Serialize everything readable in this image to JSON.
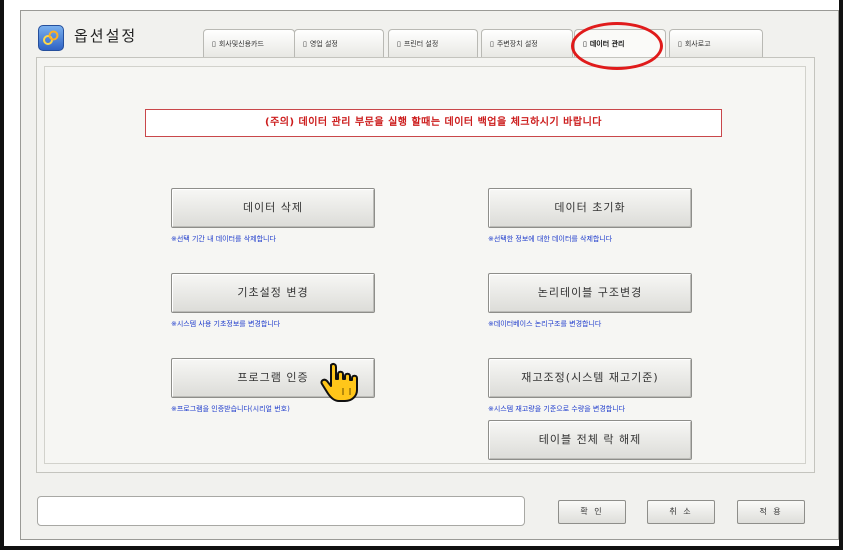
{
  "window": {
    "title": "옵션설정"
  },
  "tabs": [
    {
      "label": "회사및신용카드",
      "active": false
    },
    {
      "label": "영업 설정",
      "active": false
    },
    {
      "label": "프린터 설정",
      "active": false
    },
    {
      "label": "주변장치 설정",
      "active": false
    },
    {
      "label": "데이터 관리",
      "active": true
    },
    {
      "label": "회사로고",
      "active": false
    }
  ],
  "notice": "(주의) 데이터 관리 부문을 실행 할때는 데이터 백업을 체크하시기 바랍니다",
  "actions": {
    "delete_data": {
      "label": "데이터 삭제",
      "desc": "※선택 기간 내 데이터를 삭제합니다"
    },
    "init_data": {
      "label": "데이터 초기화",
      "desc": "※선택한 정보에 대한 데이터를 삭제합니다"
    },
    "base_settings": {
      "label": "기초설정 변경",
      "desc": "※시스템 사용 기초정보를 변경합니다"
    },
    "logic_table": {
      "label": "논리테이블 구조변경",
      "desc": "※데이터베이스 논리구조를 변경합니다"
    },
    "program_auth": {
      "label": "프로그램 인증",
      "desc": "※프로그램을 인증받습니다(시리얼 번호)"
    },
    "stock_adjust": {
      "label": "재고조정(시스템 재고기준)",
      "desc": "※시스템 재고량을 기준으로 수량을 변경합니다"
    },
    "table_unlock": {
      "label": "테이블 전체 락 해제"
    }
  },
  "footer": {
    "status_text": "",
    "confirm": "확 인",
    "cancel": "취 소",
    "apply": "적 용"
  },
  "colors": {
    "highlight_circle": "#e01b1b",
    "notice_text": "#cc1d1d",
    "description_text": "#1f3ccc"
  }
}
